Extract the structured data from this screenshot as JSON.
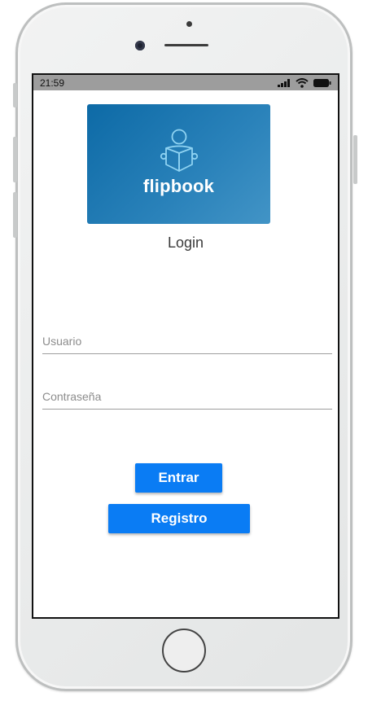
{
  "status_bar": {
    "time": "21:59",
    "icons": [
      "signal-icon",
      "wifi-icon",
      "battery-icon"
    ]
  },
  "banner": {
    "brand": "flipbook",
    "icon": "reader-book-icon",
    "gradient_start": "#0d6aa6",
    "gradient_end": "#4294c6"
  },
  "login": {
    "title": "Login",
    "username_placeholder": "Usuario",
    "password_placeholder": "Contraseña",
    "enter_label": "Entrar",
    "register_label": "Registro",
    "button_color": "#0a7cf4"
  }
}
